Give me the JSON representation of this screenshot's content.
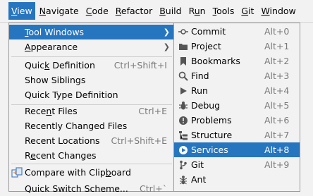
{
  "menubar": {
    "items": [
      {
        "text": "View",
        "mnemonic": "V",
        "rest": "iew"
      },
      {
        "text": "Navigate",
        "mnemonic": "N",
        "rest": "avigate"
      },
      {
        "text": "Code",
        "mnemonic": "C",
        "rest": "ode"
      },
      {
        "text": "Refactor",
        "mnemonic": "R",
        "rest": "efactor"
      },
      {
        "text": "Build",
        "mnemonic": "B",
        "rest": "uild"
      },
      {
        "text": "Run",
        "pre": "R",
        "mnemonic": "u",
        "rest": "n"
      },
      {
        "text": "Tools",
        "mnemonic": "T",
        "rest": "ools"
      },
      {
        "text": "Git",
        "mnemonic": "G",
        "rest": "it"
      },
      {
        "text": "Window",
        "mnemonic": "W",
        "rest": "indow"
      }
    ]
  },
  "view_menu": {
    "tool_windows": {
      "pre": "",
      "mnemonic": "T",
      "rest": "ool Windows"
    },
    "appearance": {
      "pre": "",
      "mnemonic": "A",
      "rest": "ppearance"
    },
    "quick_definition": {
      "pre": "Quic",
      "mnemonic": "k",
      "rest": " Definition",
      "shortcut": "Ctrl+Shift+I"
    },
    "show_siblings": {
      "label": "Show Siblings"
    },
    "quick_type_definition": {
      "label": "Quick Type Definition"
    },
    "recent_files": {
      "pre": "Rece",
      "mnemonic": "n",
      "rest": "t Files",
      "shortcut": "Ctrl+E"
    },
    "recently_changed_files": {
      "label": "Recently Changed Files"
    },
    "recent_locations": {
      "label": "Recent Locations",
      "shortcut": "Ctrl+Shift+E"
    },
    "recent_changes": {
      "pre": "R",
      "mnemonic": "e",
      "rest": "cent Changes"
    },
    "compare_clipboard": {
      "pre": "Compare with Clip",
      "mnemonic": "b",
      "rest": "oard"
    },
    "quick_switch_scheme": {
      "label": "Quick Switch Scheme...",
      "shortcut": "Ctrl+`"
    }
  },
  "tool_windows_menu": {
    "items": [
      {
        "label": "Commit",
        "shortcut": "Alt+0",
        "icon": "commit-icon"
      },
      {
        "label": "Project",
        "shortcut": "Alt+1",
        "icon": "folder-icon"
      },
      {
        "label": "Bookmarks",
        "shortcut": "Alt+2",
        "icon": "bookmark-icon"
      },
      {
        "label": "Find",
        "shortcut": "Alt+3",
        "icon": "search-icon"
      },
      {
        "label": "Run",
        "shortcut": "Alt+4",
        "icon": "play-icon"
      },
      {
        "label": "Debug",
        "shortcut": "Alt+5",
        "icon": "bug-icon"
      },
      {
        "label": "Problems",
        "shortcut": "Alt+6",
        "icon": "warning-icon"
      },
      {
        "label": "Structure",
        "shortcut": "Alt+7",
        "icon": "structure-icon"
      },
      {
        "label": "Services",
        "shortcut": "Alt+8",
        "icon": "services-icon",
        "highlighted": true
      },
      {
        "label": "Git",
        "shortcut": "Alt+9",
        "icon": "git-branch-icon"
      },
      {
        "label": "Ant",
        "shortcut": "",
        "icon": "ant-icon"
      }
    ]
  },
  "colors": {
    "highlight": "#2675bf",
    "menu_bg": "#f2f2f2",
    "shortcut_text": "#7a7a7a"
  }
}
